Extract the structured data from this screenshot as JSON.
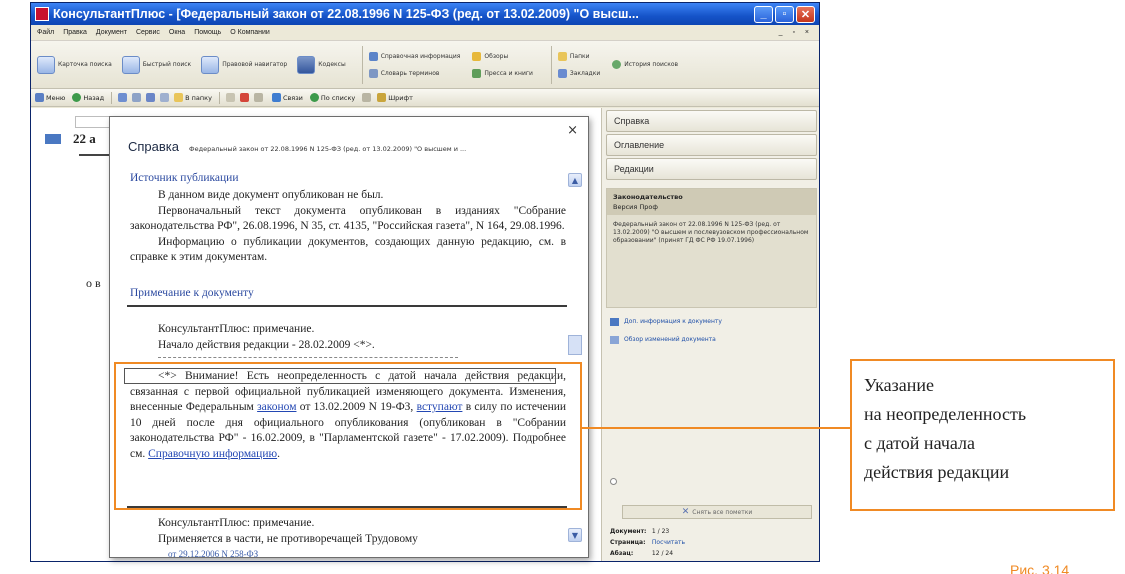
{
  "window": {
    "title": "КонсультантПлюс - [Федеральный закон от 22.08.1996 N 125-ФЗ (ред. от 13.02.2009) \"О высш..."
  },
  "menubar": {
    "items": [
      "Файл",
      "Правка",
      "Документ",
      "Сервис",
      "Окна",
      "Помощь",
      "О Компании"
    ],
    "mdi_controls": "_ ▫ ×"
  },
  "ribbon": {
    "card_search": "Карточка поиска",
    "quick_search": "Быстрый поиск",
    "legal_navigator": "Правовой навигатор",
    "codes": "Кодексы",
    "reference_info": "Справочная информация",
    "reviews": "Обзоры",
    "terms_dictionary": "Словарь терминов",
    "press_reviews": "Пресса и книги",
    "folders": "Папки",
    "search_history": "История поисков",
    "bookmarks": "Закладки"
  },
  "toolbar": {
    "menu": "Меню",
    "back": "Назад",
    "to_list": "В папку",
    "links": "Связи",
    "by_list": "По списку",
    "font": "Шрифт"
  },
  "document": {
    "date_fragment": "22 а",
    "text_fragment": "о в"
  },
  "popup": {
    "title": "Справка",
    "subtitle": "Федеральный закон от 22.08.1996 N 125-ФЗ (ред. от 13.02.2009) \"О высшем и ...",
    "close": "×",
    "section1_title": "Источник публикации",
    "p1": "В данном виде документ опубликован не был.",
    "p2": "Первоначальный текст документа опубликован в изданиях \"Собрание законодательства РФ\", 26.08.1996, N 35, ст. 4135, \"Российская газета\", N 164, 29.08.1996.",
    "p3": "Информацию о публикации документов, создающих данную редакцию, см. в справке к этим документам.",
    "section2_title": "Примечание к документу",
    "note1": "КонсультантПлюс: примечание.",
    "note2": "Начало действия редакции - 28.02.2009 <*>.",
    "warn_start": "<*> Внимание! Есть неопределенность с датой начала действия редакции, связанная с первой официальной публикацией изменяющего документа. Изменения, внесенные Федеральным",
    "warn_link1": "законом",
    "warn_mid": "от 13.02.2009 N 19-ФЗ,",
    "warn_link2": "вступают",
    "warn_end": "в силу по истечении 10 дней после дня официального опубликования (опубликован в \"Собрании законодательства РФ\" - 16.02.2009, в \"Парламентской газете\" - 17.02.2009). Подробнее см.",
    "warn_link3": "Справочную информацию",
    "note3": "КонсультантПлюс: примечание.",
    "note4": "Применяется в части, не противоречащей Трудовому",
    "bottom_fragment": "от 29.12.2006 N 258-ФЗ"
  },
  "side_panel": {
    "tab1": "Справка",
    "tab2": "Оглавление",
    "tab3": "Редакции",
    "card_head1": "Законодательство",
    "card_head2": "Версия Проф",
    "card_body": "Федеральный закон от 22.08.1996 N 125-ФЗ (ред. от 13.02.2009) \"О высшем и послевузовском профессиональном образовании\" (принят ГД ФС РФ 19.07.1996)",
    "link1": "Доп. информация к документу",
    "link2": "Обзор изменений документа",
    "clear_button": "Снять все пометки",
    "status": {
      "doc_label": "Документ:",
      "doc_value": "1 / 23",
      "page_label": "Страница:",
      "page_value": "Посчитать",
      "para_label": "Абзац:",
      "para_value": "12 / 24"
    }
  },
  "callout": {
    "line1": "Указание",
    "line2": "на неопределенность",
    "line3": "с датой начала",
    "line4": "действия редакции"
  },
  "caption": "Рис. 3.14",
  "colors": {
    "accent_orange": "#f08a24",
    "link_blue": "#2347b3",
    "titlebar_blue": "#1553c8"
  }
}
